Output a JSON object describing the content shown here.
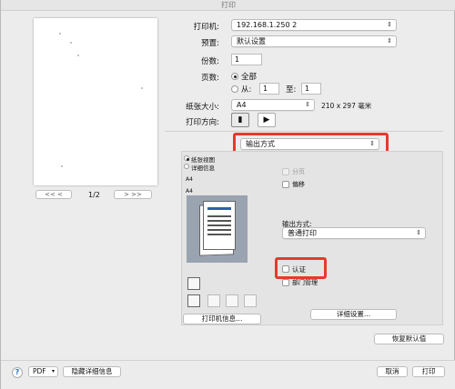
{
  "window": {
    "title": "打印"
  },
  "preview": {
    "prev_label": "<< <",
    "next_label": "> >>",
    "page": "1/2"
  },
  "printer": {
    "label": "打印机:",
    "value": "192.168.1.250 2"
  },
  "preset": {
    "label": "预置:",
    "value": "默认设置"
  },
  "copies": {
    "label": "份数:",
    "value": "1"
  },
  "pages": {
    "label": "页数:",
    "all_label": "全部",
    "from_label": "从:",
    "from_value": "1",
    "to_label": "至:",
    "to_value": "1"
  },
  "paper": {
    "label": "纸张大小:",
    "value": "A4",
    "dims": "210 x 297 毫米"
  },
  "orientation": {
    "label": "打印方向:",
    "portrait": "▮",
    "landscape": "▶"
  },
  "section_select": {
    "value": "输出方式"
  },
  "view_options": {
    "option1": "纸张视图",
    "option2": "详细信息"
  },
  "thumb_labels": {
    "a4_top": "A4",
    "a4_sub": "A4"
  },
  "output": {
    "collate_label": "分页",
    "offset_label": "偏移",
    "method_label": "输出方式:",
    "method_value": "普通打印",
    "auth_label": "认证",
    "dept_label": "部门管理",
    "details_button": "详细设置...",
    "printer_info_button": "打印机信息...",
    "restore_button": "恢复默认值"
  },
  "bottom": {
    "help": "?",
    "pdf_label": "PDF",
    "hide_details": "隐藏详细信息",
    "cancel": "取消",
    "print": "打印"
  },
  "colors": {
    "highlight": "#e8392b"
  },
  "icons": [
    "help-icon",
    "portrait-icon",
    "landscape-icon",
    "chevron-updown-icon"
  ]
}
